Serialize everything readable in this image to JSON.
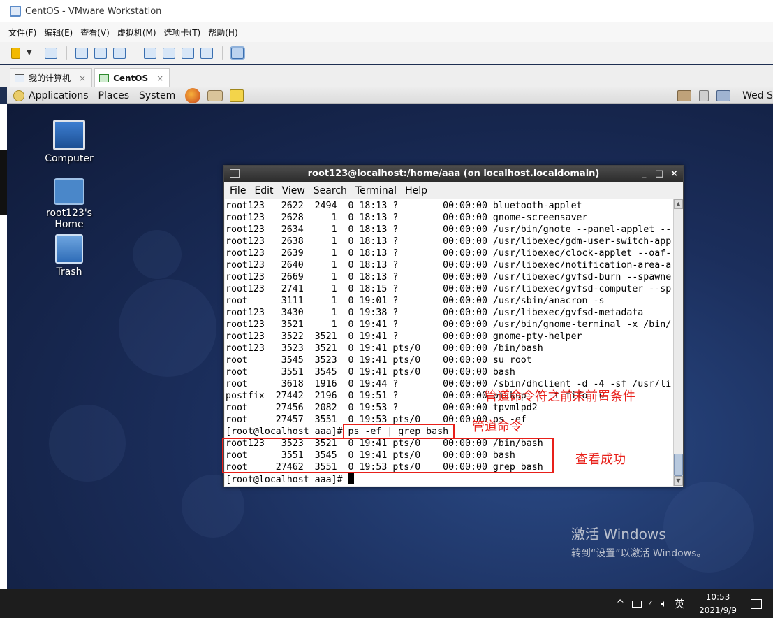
{
  "window": {
    "title": "CentOS - VMware Workstation"
  },
  "menubar": [
    "文件(F)",
    "编辑(E)",
    "查看(V)",
    "虚拟机(M)",
    "选项卡(T)",
    "帮助(H)"
  ],
  "tabs": [
    {
      "label": "我的计算机",
      "close": "×"
    },
    {
      "label": "CentOS",
      "close": "×"
    }
  ],
  "guest_panel": {
    "menus": [
      "Applications",
      "Places",
      "System"
    ],
    "clock": "Wed S"
  },
  "desktop_icons": [
    {
      "label": "Computer",
      "icon": "computer-icon"
    },
    {
      "label": "root123's Home",
      "icon": "home-folder-icon"
    },
    {
      "label": "Trash",
      "icon": "trash-icon"
    }
  ],
  "terminal": {
    "title": "root123@localhost:/home/aaa (on localhost.localdomain)",
    "controls": [
      "_",
      "□",
      "×"
    ],
    "menu": [
      "File",
      "Edit",
      "View",
      "Search",
      "Terminal",
      "Help"
    ],
    "lines": [
      "root123   2622  2494  0 18:13 ?        00:00:00 bluetooth-applet",
      "root123   2628     1  0 18:13 ?        00:00:00 gnome-screensaver",
      "root123   2634     1  0 18:13 ?        00:00:00 /usr/bin/gnote --panel-applet --",
      "root123   2638     1  0 18:13 ?        00:00:00 /usr/libexec/gdm-user-switch-app",
      "root123   2639     1  0 18:13 ?        00:00:00 /usr/libexec/clock-applet --oaf-",
      "root123   2640     1  0 18:13 ?        00:00:00 /usr/libexec/notification-area-a",
      "root123   2669     1  0 18:13 ?        00:00:00 /usr/libexec/gvfsd-burn --spawne",
      "root123   2741     1  0 18:15 ?        00:00:00 /usr/libexec/gvfsd-computer --sp",
      "root      3111     1  0 19:01 ?        00:00:00 /usr/sbin/anacron -s",
      "root123   3430     1  0 19:38 ?        00:00:00 /usr/libexec/gvfsd-metadata",
      "root123   3521     1  0 19:41 ?        00:00:00 /usr/bin/gnome-terminal -x /bin/",
      "root123   3522  3521  0 19:41 ?        00:00:00 gnome-pty-helper",
      "root123   3523  3521  0 19:41 pts/0    00:00:00 /bin/bash",
      "root      3545  3523  0 19:41 pts/0    00:00:00 su root",
      "root      3551  3545  0 19:41 pts/0    00:00:00 bash",
      "root      3618  1916  0 19:44 ?        00:00:00 /sbin/dhclient -d -4 -sf /usr/li",
      "postfix  27442  2196  0 19:51 ?        00:00:00 pickup -l -t fifo -u",
      "root     27456  2082  0 19:53 ?        00:00:00 tpvmlpd2",
      "root     27457  3551  0 19:53 pts/0    00:00:00 ps -ef",
      "[root@localhost aaa]# ps -ef | grep bash",
      "root123   3523  3521  0 19:41 pts/0    00:00:00 /bin/bash",
      "root      3551  3545  0 19:41 pts/0    00:00:00 bash",
      "root     27462  3551  0 19:53 pts/0    00:00:00 grep bash",
      "[root@localhost aaa]# "
    ]
  },
  "annotations": {
    "pipe_symbol_note": "管道命令符之前未前置条件",
    "pipe_command_note": "管道命令",
    "success_note": "查看成功"
  },
  "watermark": {
    "title": "激活 Windows",
    "subtitle": "转到“设置”以激活 Windows。"
  },
  "taskbar": {
    "caret": "^",
    "wifi": "◜",
    "ime": "英",
    "time": "10:53",
    "date": "2021/9/9"
  }
}
